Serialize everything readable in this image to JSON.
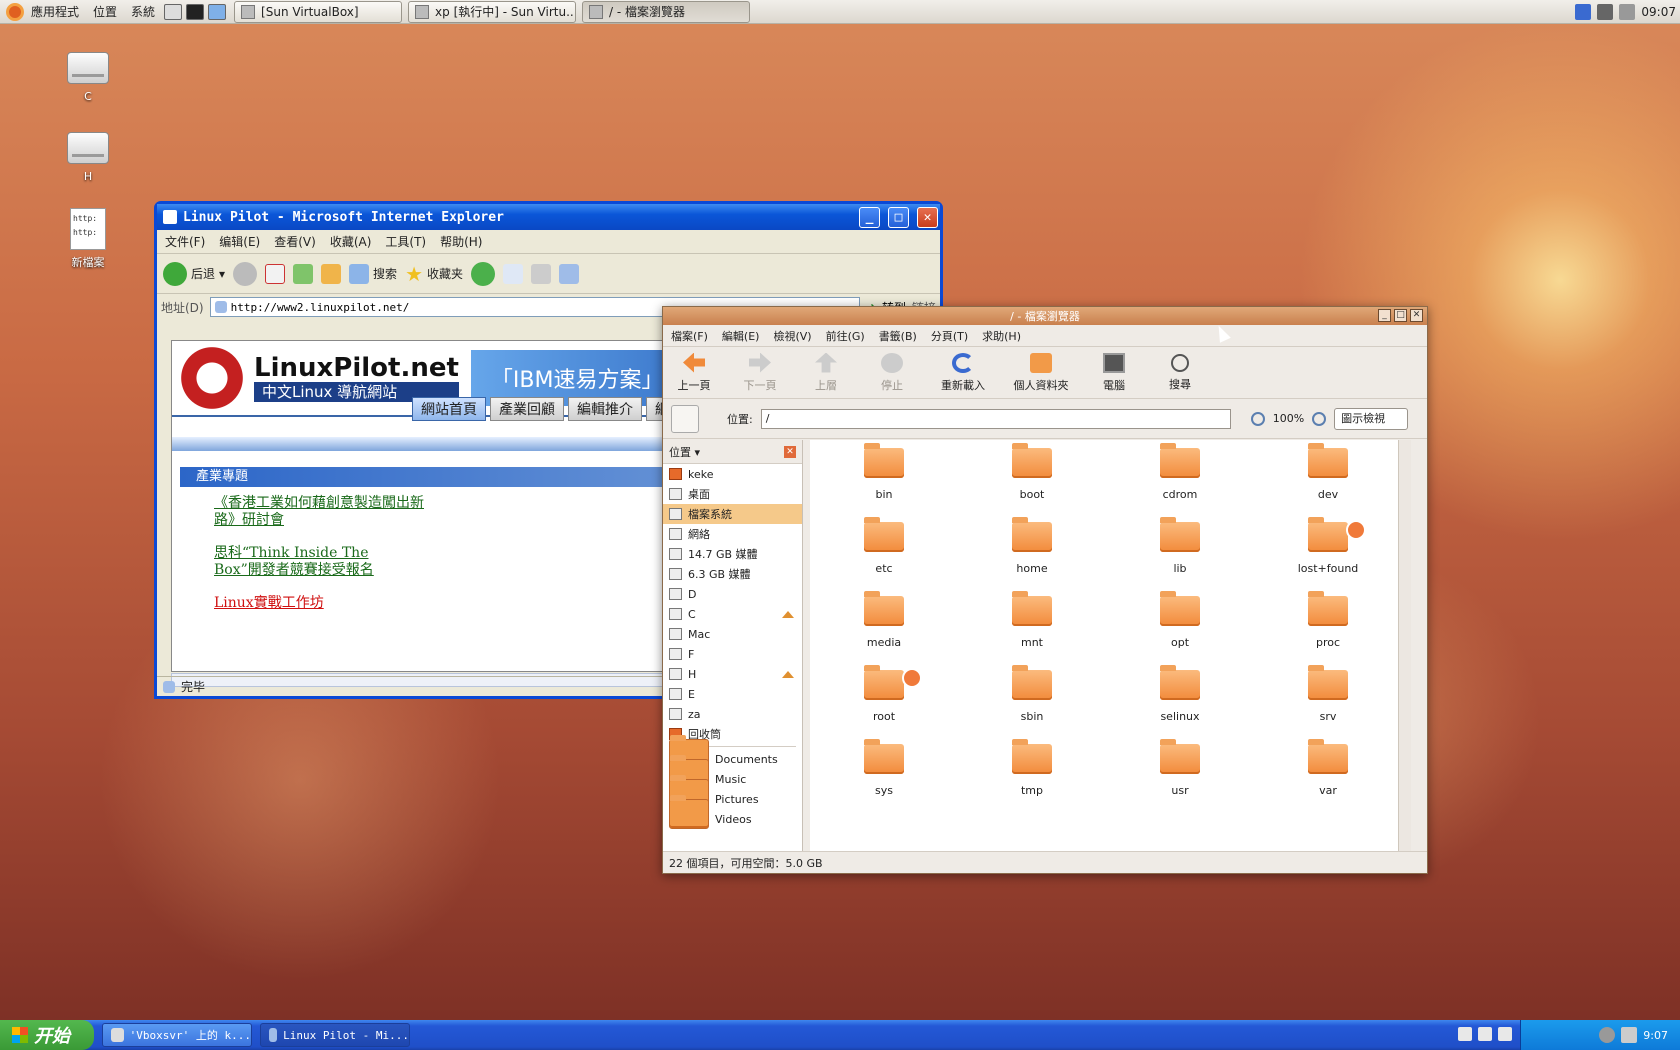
{
  "top_panel": {
    "menus": [
      "應用程式",
      "位置",
      "系統"
    ],
    "tasks": [
      {
        "label": "[Sun VirtualBox]"
      },
      {
        "label": "xp [執行中] - Sun Virtu..."
      },
      {
        "label": "/ - 檔案瀏覽器"
      }
    ],
    "clock": "09:07"
  },
  "desktop": {
    "icons": [
      {
        "label": "C"
      },
      {
        "label": "H"
      },
      {
        "label": "新檔案",
        "file_text": "http:\nhttp:"
      }
    ]
  },
  "ie": {
    "title": "Linux Pilot - Microsoft Internet Explorer",
    "menu": [
      "文件(F)",
      "编辑(E)",
      "查看(V)",
      "收藏(A)",
      "工具(T)",
      "帮助(H)"
    ],
    "toolbar": {
      "back": "后退",
      "search": "搜索",
      "favorites": "收藏夹"
    },
    "address_label": "地址(D)",
    "address": "http://www2.linuxpilot.net/",
    "go": "转到",
    "links": "链接",
    "status": "完毕",
    "page": {
      "site_name": "LinuxPilot.net",
      "site_sub": "中文Linux 導航網站",
      "banner": "「IBM速易方案」電子通訊",
      "tabs": [
        "網站首頁",
        "產業回顧",
        "編輯推介",
        "網"
      ],
      "section": "產業專題",
      "news": [
        "《香港工業如何藉創意製造闖出新路》研討會",
        "思科“Think Inside The Box”開發者競賽接受報名",
        "Linux實戰工作坊"
      ]
    }
  },
  "fb": {
    "title": "/ - 檔案瀏覽器",
    "menu": [
      "檔案(F)",
      "編輯(E)",
      "檢視(V)",
      "前往(G)",
      "書籤(B)",
      "分頁(T)",
      "求助(H)"
    ],
    "toolbar": {
      "back": "上一頁",
      "forward": "下一頁",
      "up": "上層",
      "stop": "停止",
      "reload": "重新載入",
      "home": "個人資料夾",
      "computer": "電腦",
      "search": "搜尋"
    },
    "location_label": "位置:",
    "location": "/",
    "zoom": "100%",
    "view": "圖示檢視",
    "sidebar_title": "位置",
    "sidebar": [
      "keke",
      "桌面",
      "檔案系統",
      "網絡",
      "14.7 GB 媒體",
      "6.3 GB 媒體",
      "D",
      "C",
      "Mac",
      "F",
      "H",
      "E",
      "za",
      "回收筒"
    ],
    "bookmarks": [
      "Documents",
      "Music",
      "Pictures",
      "Videos"
    ],
    "files": [
      "bin",
      "boot",
      "cdrom",
      "dev",
      "etc",
      "home",
      "lib",
      "lost+found",
      "media",
      "mnt",
      "opt",
      "proc",
      "root",
      "sbin",
      "selinux",
      "srv",
      "sys",
      "tmp",
      "usr",
      "var"
    ],
    "status": "22 個項目，可用空間：5.0 GB"
  },
  "xp_taskbar": {
    "start": "开始",
    "tasks": [
      "'Vboxsvr' 上的 k...",
      "Linux Pilot - Mi..."
    ],
    "clock": "9:07"
  }
}
